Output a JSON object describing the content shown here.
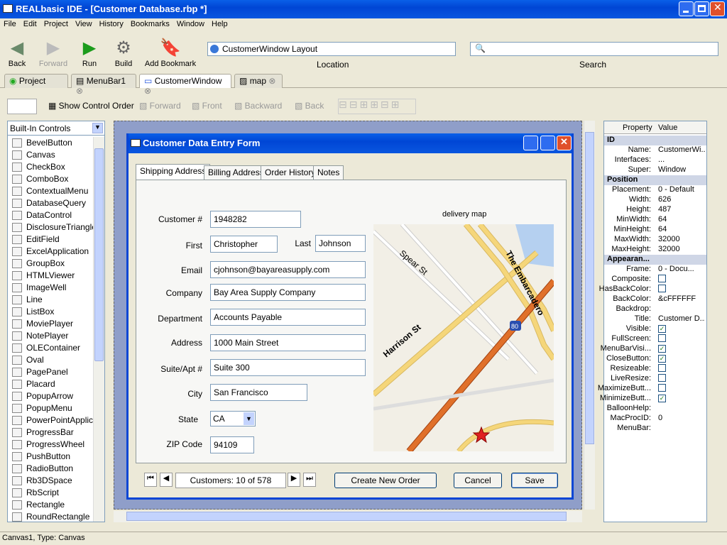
{
  "window": {
    "title": "REALbasic IDE - [Customer Database.rbp *]"
  },
  "menu": [
    "File",
    "Edit",
    "Project",
    "View",
    "History",
    "Bookmarks",
    "Window",
    "Help"
  ],
  "toolbar": {
    "back": "Back",
    "forward": "Forward",
    "run": "Run",
    "build": "Build",
    "add_bookmark": "Add Bookmark",
    "location_label": "Location",
    "location_value": "CustomerWindow Layout",
    "search_label": "Search"
  },
  "tabs": [
    "Project",
    "MenuBar1",
    "CustomerWindow",
    "map"
  ],
  "layout_toolbar": {
    "show_control_order": "Show Control Order",
    "forward": "Forward",
    "front": "Front",
    "backward": "Backward",
    "back": "Back"
  },
  "controls": {
    "selector": "Built-In Controls",
    "items": [
      "BevelButton",
      "Canvas",
      "CheckBox",
      "ComboBox",
      "ContextualMenu",
      "DatabaseQuery",
      "DataControl",
      "DisclosureTriangle",
      "EditField",
      "ExcelApplication",
      "GroupBox",
      "HTMLViewer",
      "ImageWell",
      "Line",
      "ListBox",
      "MoviePlayer",
      "NotePlayer",
      "OLEContainer",
      "Oval",
      "PagePanel",
      "Placard",
      "PopupArrow",
      "PopupMenu",
      "PowerPointApplic...",
      "ProgressBar",
      "ProgressWheel",
      "PushButton",
      "RadioButton",
      "Rb3DSpace",
      "RbScript",
      "Rectangle",
      "RoundRectangle"
    ]
  },
  "form": {
    "title": "Customer Data Entry Form",
    "tabs": [
      "Shipping Address",
      "Billing Address",
      "Order History",
      "Notes"
    ],
    "fields": {
      "customer_no_label": "Customer #",
      "customer_no": "1948282",
      "first_label": "First",
      "first": "Christopher",
      "last_label": "Last",
      "last": "Johnson",
      "email_label": "Email",
      "email": "cjohnson@bayareasupply.com",
      "company_label": "Company",
      "company": "Bay Area Supply Company",
      "department_label": "Department",
      "department": "Accounts Payable",
      "address_label": "Address",
      "address": "1000 Main Street",
      "suite_label": "Suite/Apt #",
      "suite": "Suite 300",
      "city_label": "City",
      "city": "San Francisco",
      "state_label": "State",
      "state": "CA",
      "zip_label": "ZIP Code",
      "zip": "94109"
    },
    "map_label": "delivery map",
    "map_streets": [
      "Spear St",
      "Harrison St",
      "The Embarcadero",
      "80"
    ],
    "nav_record": "Customers: 10 of 578",
    "create_order": "Create New Order",
    "cancel": "Cancel",
    "save": "Save"
  },
  "properties": {
    "col_property": "Property",
    "col_value": "Value",
    "groups": [
      {
        "name": "ID",
        "rows": [
          [
            "Name:",
            "CustomerWi..."
          ],
          [
            "Interfaces:",
            "..."
          ],
          [
            "Super:",
            "Window"
          ]
        ]
      },
      {
        "name": "Position",
        "rows": [
          [
            "Placement:",
            "0 - Default"
          ],
          [
            "Width:",
            "626"
          ],
          [
            "Height:",
            "487"
          ],
          [
            "MinWidth:",
            "64"
          ],
          [
            "MinHeight:",
            "64"
          ],
          [
            "MaxWidth:",
            "32000"
          ],
          [
            "MaxHeight:",
            "32000"
          ]
        ]
      },
      {
        "name": "Appearan...",
        "rows": [
          [
            "Frame:",
            "0 - Docu..."
          ],
          [
            "Composite:",
            ""
          ],
          [
            "HasBackColor:",
            ""
          ],
          [
            "BackColor:",
            "&cFFFFFF"
          ],
          [
            "Backdrop:",
            ""
          ],
          [
            "Title:",
            "Customer D..."
          ],
          [
            "Visible:",
            "✓"
          ],
          [
            "FullScreen:",
            ""
          ],
          [
            "MenuBarVisi...",
            "✓"
          ],
          [
            "CloseButton:",
            "✓"
          ],
          [
            "Resizeable:",
            ""
          ],
          [
            "LiveResize:",
            ""
          ],
          [
            "MaximizeButt...",
            ""
          ],
          [
            "MinimizeButt...",
            "✓"
          ],
          [
            "BalloonHelp:",
            ""
          ],
          [
            "MacProcID:",
            "0"
          ],
          [
            "MenuBar:",
            ""
          ]
        ]
      }
    ]
  },
  "status": "Canvas1, Type: Canvas"
}
